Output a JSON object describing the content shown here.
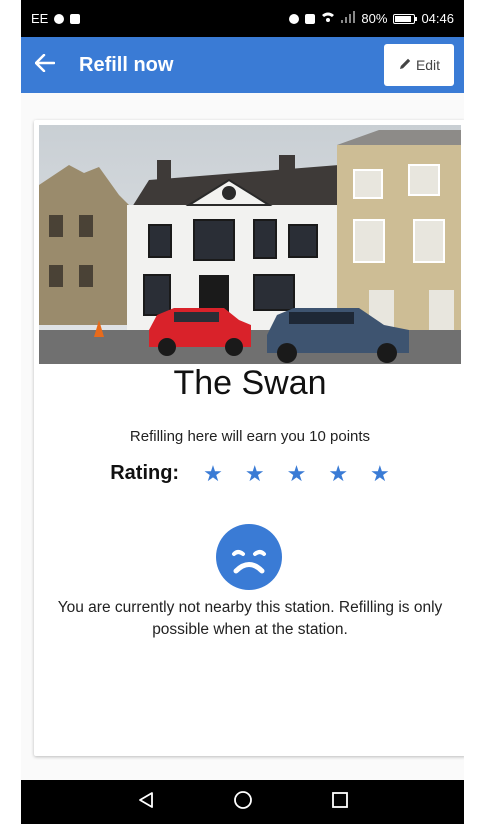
{
  "statusbar": {
    "carrier": "EE",
    "battery_percent": "80%",
    "time": "04:46"
  },
  "appbar": {
    "title": "Refill now",
    "edit_label": "Edit"
  },
  "station": {
    "name": "The Swan",
    "points_text": "Refilling here will earn you 10 points",
    "rating_label": "Rating:",
    "rating_value": 5,
    "rating_max": 5,
    "warning_text": "You are currently not nearby this station. Refilling is only possible when at the station."
  },
  "colors": {
    "accent": "#3a7bd5",
    "status_bar": "#000000"
  },
  "icons": {
    "back": "arrow-left-icon",
    "edit": "pencil-icon",
    "star": "star-icon",
    "sad": "sad-face-icon",
    "nav_back": "triangle-back-icon",
    "nav_home": "circle-home-icon",
    "nav_recent": "square-recents-icon"
  }
}
